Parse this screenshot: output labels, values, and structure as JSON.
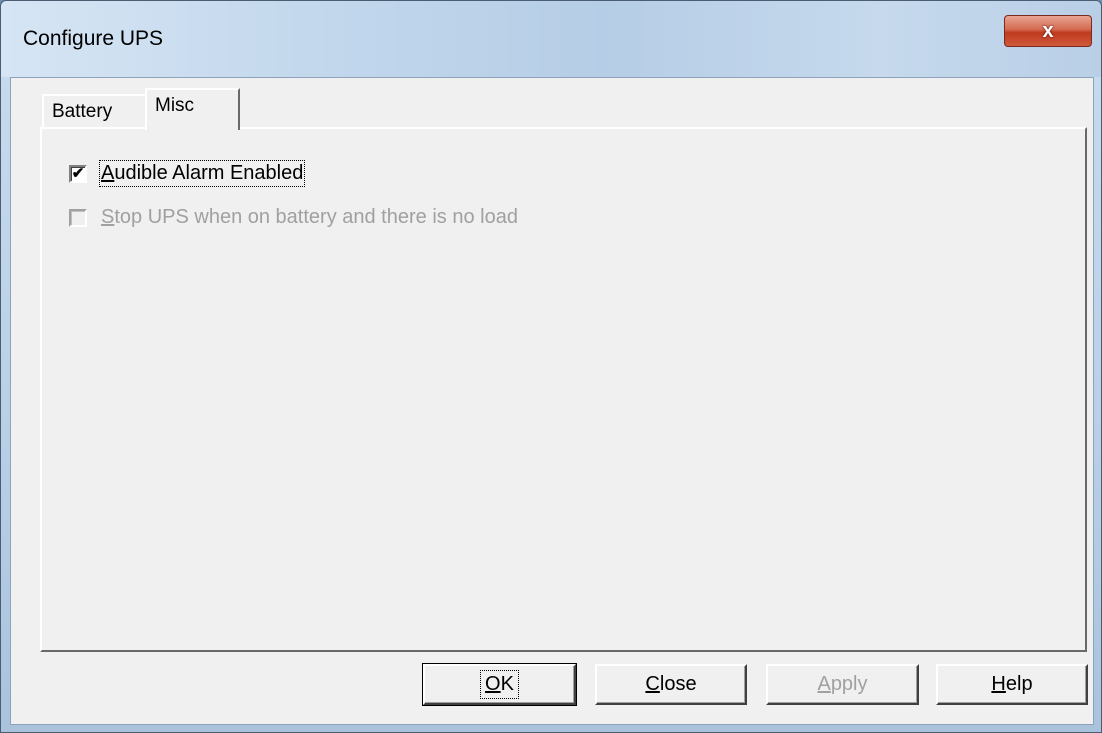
{
  "window": {
    "title": "Configure UPS",
    "close_glyph": "x"
  },
  "tabs": [
    {
      "label": "Battery",
      "active": false
    },
    {
      "label": "Misc",
      "active": true
    }
  ],
  "misc": {
    "audible_alarm": {
      "mnemonic": "A",
      "rest": "udible Alarm Enabled",
      "checked": true,
      "enabled": true
    },
    "stop_ups": {
      "mnemonic": "S",
      "rest": "top UPS when on battery and there is no load",
      "checked": false,
      "enabled": false
    }
  },
  "buttons": {
    "ok": {
      "mnemonic": "O",
      "rest": "K"
    },
    "close": {
      "mnemonic": "C",
      "rest": "lose"
    },
    "apply": {
      "mnemonic": "A",
      "rest": "pply",
      "enabled": false
    },
    "help": {
      "mnemonic": "H",
      "rest": "elp"
    }
  },
  "icons": {
    "check_mark": "✔"
  },
  "colors": {
    "dialog_bg": "#f0f0f0",
    "close_button": "#c0391e",
    "disabled_text": "#a0a0a0"
  }
}
